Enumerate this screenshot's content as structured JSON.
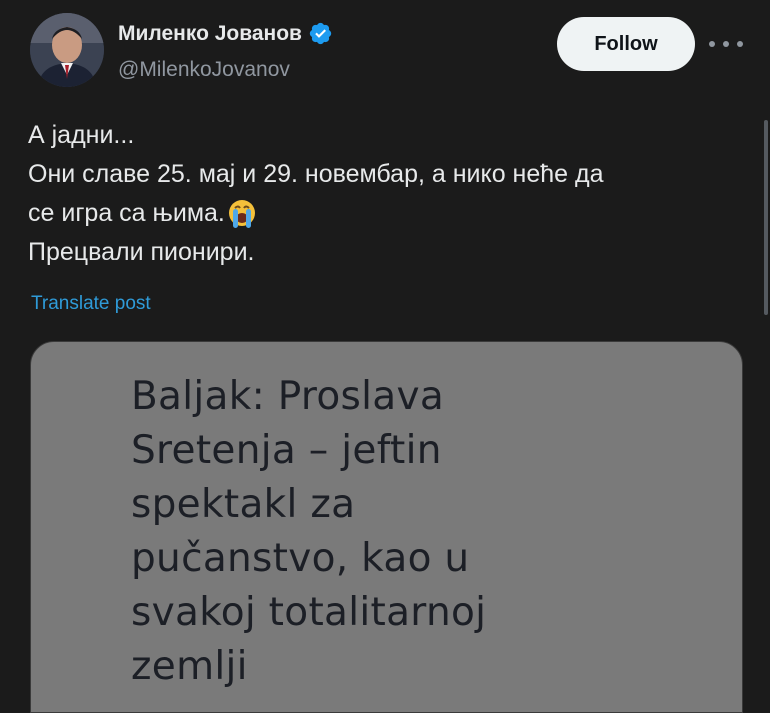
{
  "author": {
    "name": "Миленко Јованов",
    "handle": "@MilenkoJovanov",
    "verified": true
  },
  "actions": {
    "follow_label": "Follow",
    "more_icon": "more-horizontal-icon"
  },
  "post": {
    "lines": [
      "А јадни...",
      "Они славе 25. мај и 29. новембар, а нико неће да",
      "се игра са њима.",
      "Прецвали пионири."
    ],
    "emoji": "loudly-crying-face-icon",
    "translate_label": "Translate post"
  },
  "image_card": {
    "headline_lines": [
      "Baljak: Proslava",
      "Sretenja – jeftin",
      "spektakl za",
      "pučanstvo, kao u",
      "svakoj totalitarnoj",
      "zemlji"
    ]
  },
  "colors": {
    "background": "#1b1b1b",
    "accent_link": "#2f9bd8",
    "verified": "#1d9bf0",
    "follow_bg": "#eff3f4",
    "card_bg": "#7a7a7a"
  }
}
